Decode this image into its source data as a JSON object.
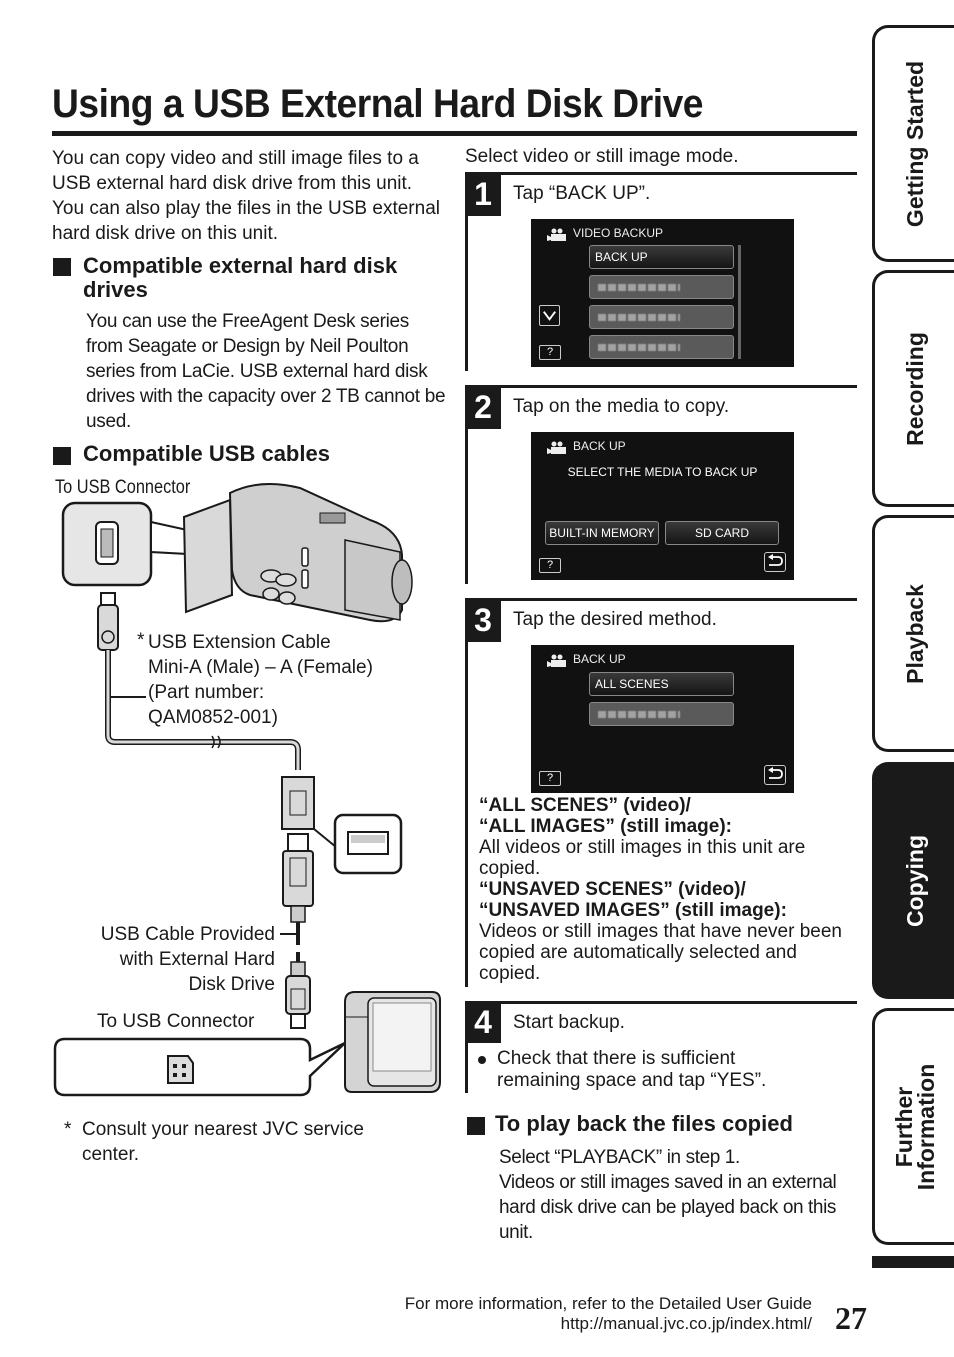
{
  "page": {
    "title": "Using a USB External Hard Disk Drive",
    "page_number": "27"
  },
  "left": {
    "intro": "You can copy video and still image files to a USB external hard disk drive from this unit. You can also play the files in the USB external hard disk drive on this unit.",
    "compatible_drives": {
      "heading": "Compatible external hard disk drives",
      "text": "You can use the FreeAgent Desk series from Seagate or Design by Neil Poulton series from LaCie. USB external hard disk drives with the capacity over 2 TB cannot be used."
    },
    "compatible_cables": {
      "heading": "Compatible USB cables"
    },
    "diagram": {
      "to_usb_connector_top": "To USB Connector",
      "extension_cable_star": "*",
      "extension_cable_lines": [
        "USB Extension Cable",
        "Mini-A (Male) – A (Female)",
        "(Part number:",
        "QAM0852-001)"
      ],
      "provided_cable_lines": [
        "USB Cable Provided",
        "with External Hard",
        "Disk Drive"
      ],
      "to_usb_connector_bottom": "To USB Connector"
    },
    "footnote": {
      "star": "*",
      "line1": "Consult your nearest JVC service",
      "line2": "center."
    }
  },
  "right": {
    "select_mode": "Select video or still image mode.",
    "steps": [
      {
        "number": "1",
        "title": "Tap “BACK UP”.",
        "screen": {
          "header": "VIDEO BACKUP",
          "buttons": [
            "BACK UP",
            "",
            "",
            ""
          ],
          "help": "?",
          "icons": [
            "camcorder-icon",
            "chevron-down-icon",
            "help-icon"
          ]
        }
      },
      {
        "number": "2",
        "title": "Tap on the media to copy.",
        "screen": {
          "header": "BACK UP",
          "message": "SELECT THE MEDIA TO BACK UP",
          "buttons": [
            "BUILT-IN MEMORY",
            "SD CARD"
          ],
          "help": "?",
          "icons": [
            "camcorder-icon",
            "help-icon",
            "back-icon"
          ]
        }
      },
      {
        "number": "3",
        "title": "Tap the desired method.",
        "screen": {
          "header": "BACK UP",
          "buttons": [
            "ALL SCENES",
            ""
          ],
          "help": "?",
          "icons": [
            "camcorder-icon",
            "help-icon",
            "back-icon"
          ]
        },
        "notes": [
          {
            "bold": "“ALL SCENES” (video)/",
            "bold2": "“ALL IMAGES” (still image):",
            "text": "All videos or still images in this unit are copied."
          },
          {
            "bold": "“UNSAVED SCENES” (video)/",
            "bold2": "“UNSAVED IMAGES” (still image):",
            "text": "Videos or still images that have never been copied are automatically selected and copied."
          }
        ]
      },
      {
        "number": "4",
        "title": "Start backup.",
        "bullet": "Check that there is sufficient remaining space and tap “YES”."
      }
    ],
    "playback": {
      "heading": "To play back the files copied",
      "line1": "Select “PLAYBACK” in step 1.",
      "line2": "Videos or still images saved in an external hard disk drive can be played back on this unit."
    }
  },
  "footer": {
    "line1": "For more information, refer to the Detailed User Guide",
    "line2": "http://manual.jvc.co.jp/index.html/"
  },
  "side_tabs": [
    {
      "label": "Getting Started",
      "active": false
    },
    {
      "label": "Recording",
      "active": false
    },
    {
      "label": "Playback",
      "active": false
    },
    {
      "label": "Copying",
      "active": true
    },
    {
      "label": "Further Information",
      "label_line1": "Further",
      "label_line2": "Information",
      "active": false
    }
  ]
}
